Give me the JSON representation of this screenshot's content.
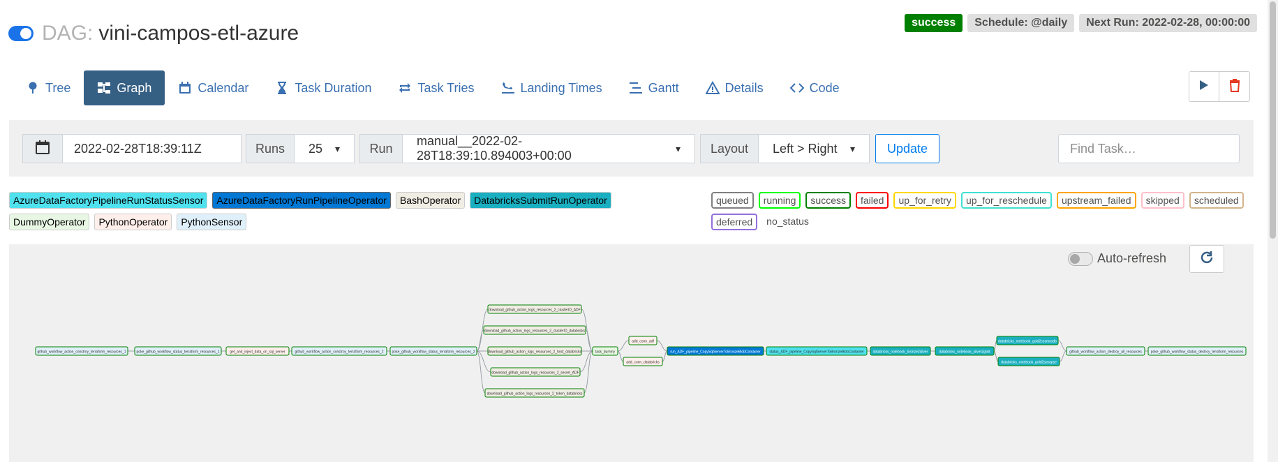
{
  "dag": {
    "prefix": "DAG:",
    "name": "vini-campos-etl-azure",
    "status": "success",
    "schedule": "Schedule: @daily",
    "next_run": "Next Run: 2022-02-28, 00:00:00"
  },
  "nav": [
    {
      "label": "Tree",
      "icon": "tree-icon"
    },
    {
      "label": "Graph",
      "icon": "graph-icon",
      "active": true
    },
    {
      "label": "Calendar",
      "icon": "calendar-icon"
    },
    {
      "label": "Task Duration",
      "icon": "hourglass-icon"
    },
    {
      "label": "Task Tries",
      "icon": "repeat-icon"
    },
    {
      "label": "Landing Times",
      "icon": "plane-landing-icon"
    },
    {
      "label": "Gantt",
      "icon": "gantt-icon"
    },
    {
      "label": "Details",
      "icon": "warning-icon"
    },
    {
      "label": "Code",
      "icon": "code-icon"
    }
  ],
  "controls": {
    "base_date": "2022-02-28T18:39:11Z",
    "runs_label": "Runs",
    "runs_value": "25",
    "run_label": "Run",
    "run_value": "manual__2022-02-28T18:39:10.894003+00:00",
    "layout_label": "Layout",
    "layout_value": "Left > Right",
    "update_label": "Update",
    "find_placeholder": "Find Task…"
  },
  "operators": [
    {
      "label": "AzureDataFactoryPipelineRunStatusSensor",
      "color": "#4fe1ee"
    },
    {
      "label": "AzureDataFactoryRunPipelineOperator",
      "color": "#0078d4"
    },
    {
      "label": "BashOperator",
      "color": "#f0ede4"
    },
    {
      "label": "DatabricksSubmitRunOperator",
      "color": "#1aafc0"
    },
    {
      "label": "DummyOperator",
      "color": "#e8f7e4"
    },
    {
      "label": "PythonOperator",
      "color": "#ffefeb"
    },
    {
      "label": "PythonSensor",
      "color": "#e0f0fa"
    }
  ],
  "states": [
    {
      "label": "queued",
      "color": "#808080"
    },
    {
      "label": "running",
      "color": "#00ff00"
    },
    {
      "label": "success",
      "color": "#008000"
    },
    {
      "label": "failed",
      "color": "#ff0000"
    },
    {
      "label": "up_for_retry",
      "color": "#ffd700"
    },
    {
      "label": "up_for_reschedule",
      "color": "#40e0d0"
    },
    {
      "label": "upstream_failed",
      "color": "#ffa500"
    },
    {
      "label": "skipped",
      "color": "#ffc0cb"
    },
    {
      "label": "scheduled",
      "color": "#d2b48c"
    },
    {
      "label": "deferred",
      "color": "#9370db"
    },
    {
      "label": "no_status",
      "color": ""
    }
  ],
  "graph": {
    "autorefresh_label": "Auto-refresh",
    "tasks": [
      {
        "id": "github_workflow_action_constroy_terraform_resources_1",
        "color": "#e0f0fa"
      },
      {
        "id": "poke_github_workflow_status_terraform_resources_1",
        "color": "#e0f0fa"
      },
      {
        "id": "get_and_inject_data_on_sql_server",
        "color": "#ffefeb"
      },
      {
        "id": "github_workflow_action_constroy_terraform_resources_2",
        "color": "#e0f0fa"
      },
      {
        "id": "poke_github_workflow_status_terraform_resources_2",
        "color": "#e0f0fa"
      },
      {
        "id": "download_github_action_logs_resources_2_clusterID_ADF",
        "color": "#f0ede4"
      },
      {
        "id": "download_github_action_logs_resources_2_clusterID_databricks",
        "color": "#f0ede4"
      },
      {
        "id": "download_github_action_logs_resources_2_host_databricks",
        "color": "#f0ede4"
      },
      {
        "id": "download_github_action_logs_resources_2_secret_ADF",
        "color": "#f0ede4"
      },
      {
        "id": "download_github_action_logs_resources_2_token_databricks",
        "color": "#f0ede4"
      },
      {
        "id": "task_dummy",
        "color": "#e8f7e4"
      },
      {
        "id": "add_conn_adf",
        "color": "#ffefeb"
      },
      {
        "id": "add_conn_databricks",
        "color": "#ffefeb"
      },
      {
        "id": "run_ADF_pipeline_CopySqlServerToBronzeBlobContainer",
        "color": "#0078d4"
      },
      {
        "id": "status_ADF_pipeline_CopySqlServerToBronzeBlobContainer",
        "color": "#4fe1ee"
      },
      {
        "id": "databricks_notebook_bronze2silver",
        "color": "#1aafc0"
      },
      {
        "id": "databricks_notebook_silver2gold",
        "color": "#1aafc0"
      },
      {
        "id": "databricks_notebook_gold2cosmosdb",
        "color": "#1aafc0"
      },
      {
        "id": "databricks_notebook_gold2synapse",
        "color": "#1aafc0"
      },
      {
        "id": "github_workflow_action_destroy_all_resources",
        "color": "#e0f0fa"
      },
      {
        "id": "poke_github_workflow_status_destroy_terraform_resources",
        "color": "#e0f0fa"
      }
    ]
  }
}
